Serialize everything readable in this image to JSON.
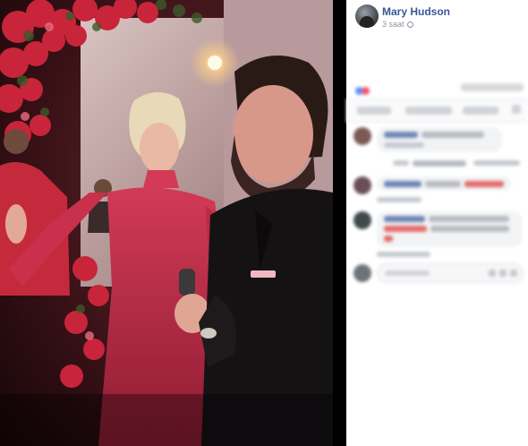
{
  "post": {
    "author": "Mary Hudson",
    "timestamp": "3 saat"
  },
  "colors": {
    "author_link": "#365899",
    "meta_gray": "#90949c",
    "photo_background": "#000000"
  },
  "icons": {
    "privacy": "globe-icon",
    "like": "like-reaction-icon",
    "love": "love-reaction-icon"
  }
}
